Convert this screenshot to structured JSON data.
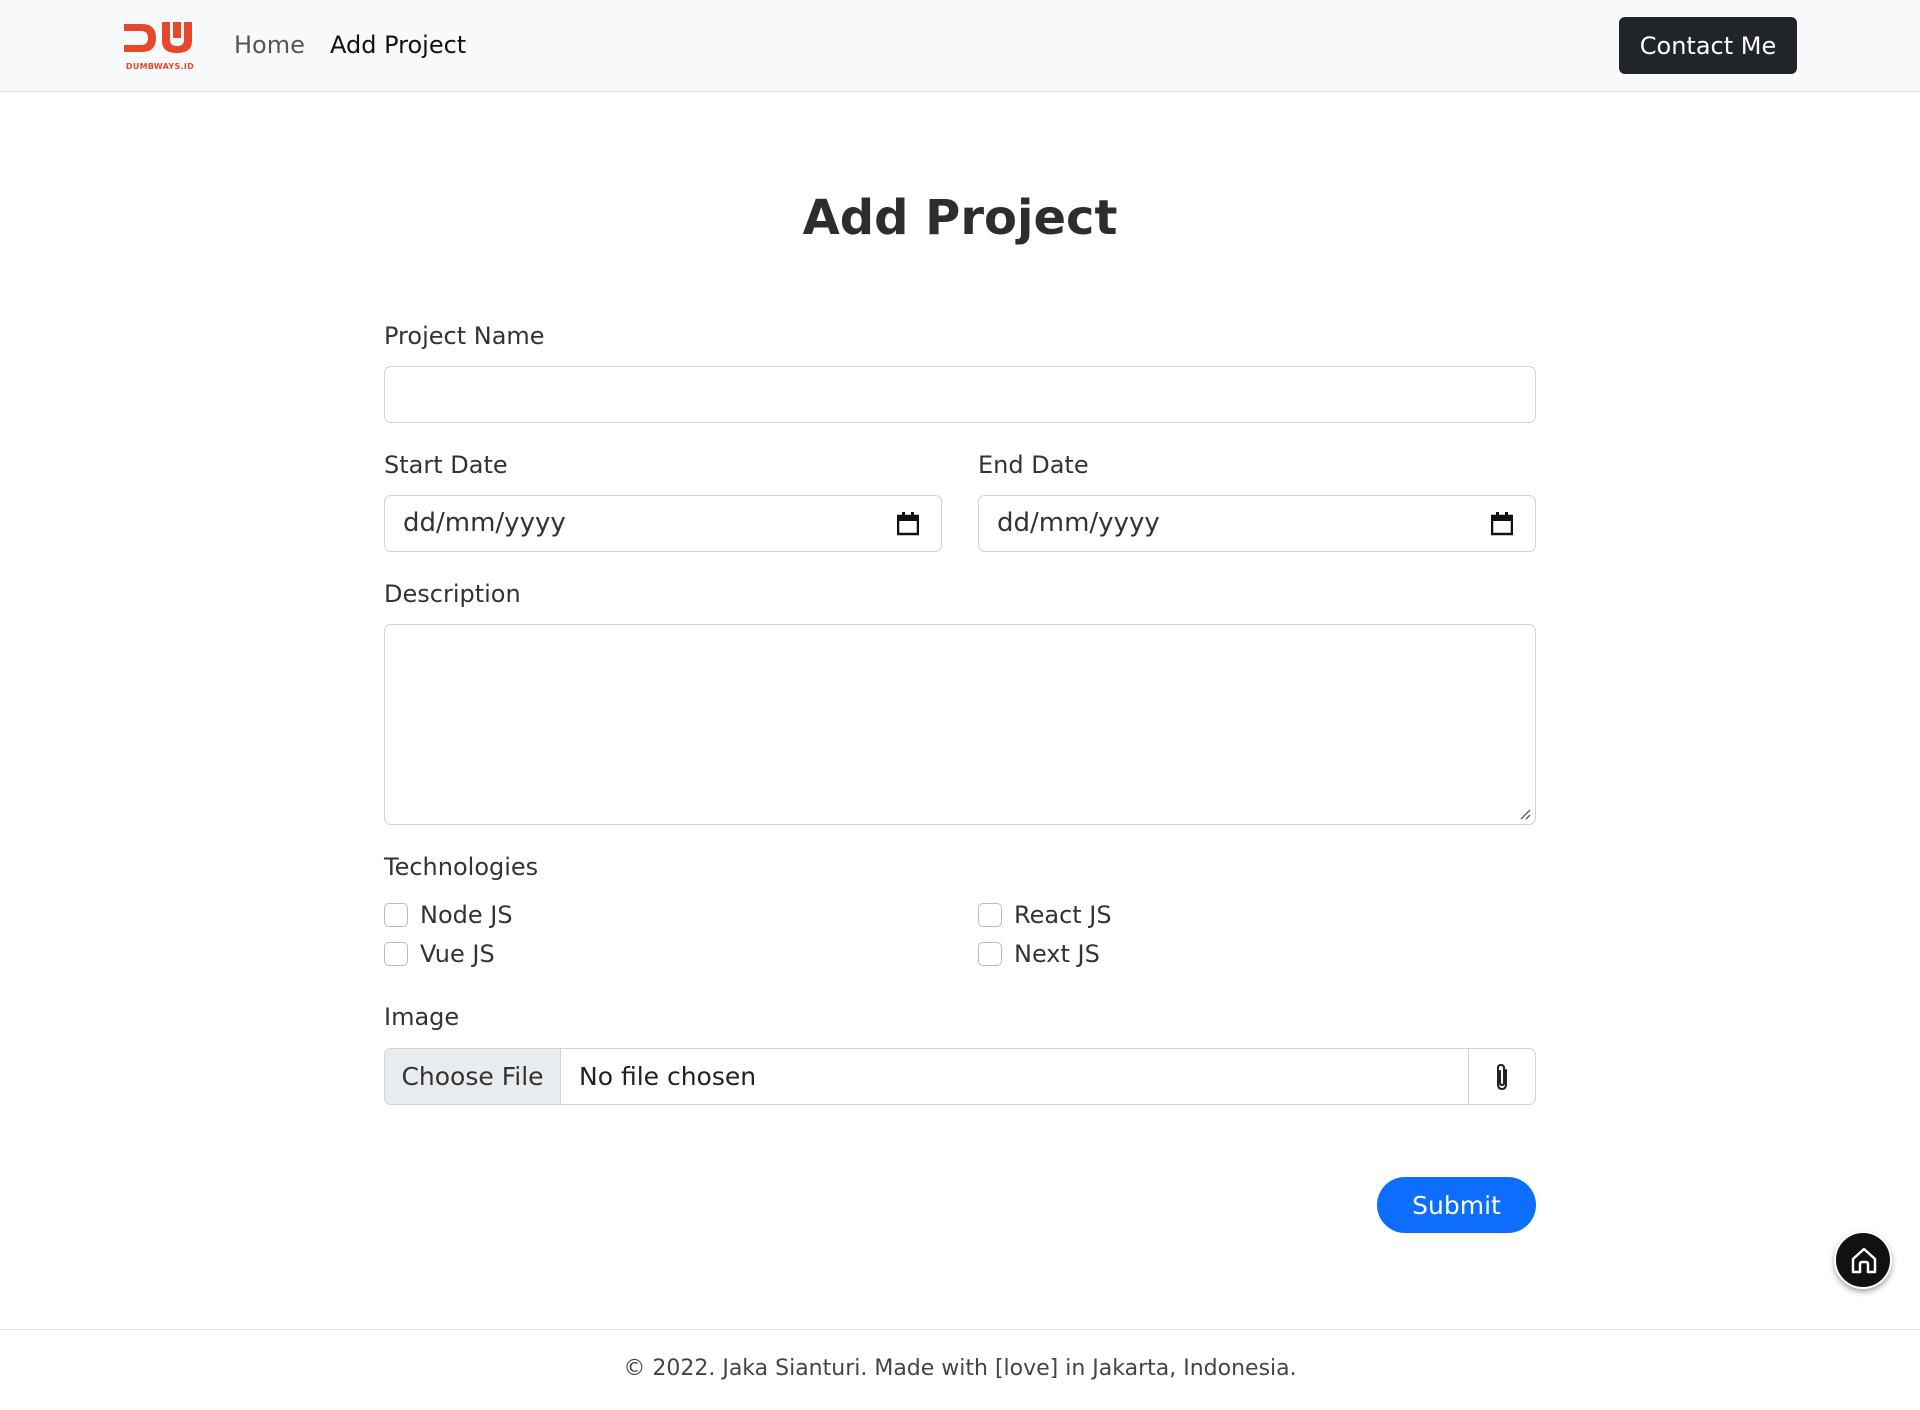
{
  "navbar": {
    "logo_text": "DUMBWAYS.ID",
    "links": [
      {
        "label": "Home"
      },
      {
        "label": "Add Project"
      }
    ],
    "contact_label": "Contact Me"
  },
  "page": {
    "title": "Add Project"
  },
  "form": {
    "project_name": {
      "label": "Project Name",
      "value": ""
    },
    "start_date": {
      "label": "Start Date",
      "value": "dd/mm/yyyy"
    },
    "end_date": {
      "label": "End Date",
      "value": "dd/mm/yyyy"
    },
    "description": {
      "label": "Description",
      "value": ""
    },
    "technologies": {
      "label": "Technologies",
      "options": [
        {
          "label": "Node JS",
          "checked": false
        },
        {
          "label": "React JS",
          "checked": false
        },
        {
          "label": "Vue JS",
          "checked": false
        },
        {
          "label": "Next JS",
          "checked": false
        }
      ]
    },
    "image": {
      "label": "Image",
      "button_label": "Choose File",
      "status": "No file chosen"
    },
    "submit_label": "Submit"
  },
  "footer": {
    "text": "© 2022. Jaka Sianturi. Made with [love] in Jakarta, Indonesia."
  },
  "colors": {
    "brand": "#e8472b",
    "primary": "#0d6efd",
    "dark": "#212529"
  }
}
